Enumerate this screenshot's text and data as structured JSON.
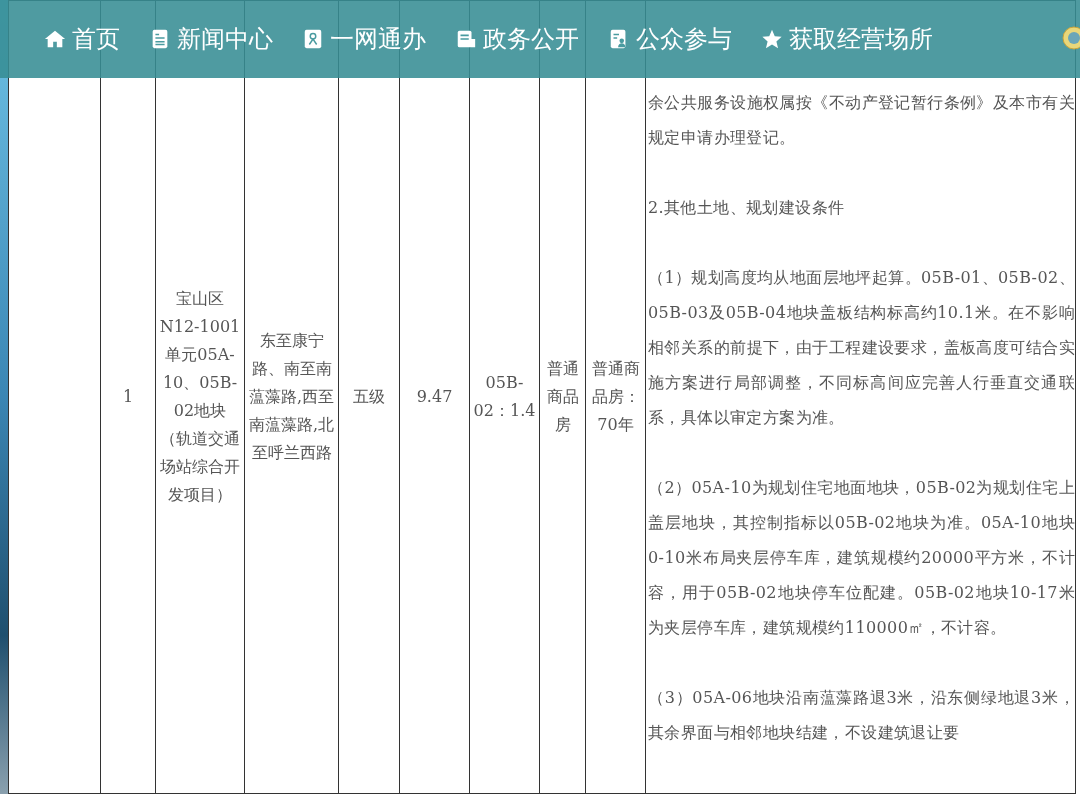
{
  "nav": {
    "items": [
      {
        "label": "首页"
      },
      {
        "label": "新闻中心"
      },
      {
        "label": "一网通办"
      },
      {
        "label": "政务公开"
      },
      {
        "label": "公众参与"
      },
      {
        "label": "获取经营场所"
      }
    ]
  },
  "table": {
    "row": {
      "cells": [
        "1",
        "宝山区N12-1001单元05A-10、05B-02地块（轨道交通场站综合开发项目）",
        "东至康宁路、南至南蕰藻路,西至南蕰藻路,北至呼兰西路",
        "五级",
        "9.47",
        "05B-02：1.4",
        "普通商品房",
        "普通商品房：70年"
      ],
      "conditions": [
        "余公共服务设施权属按《不动产登记暂行条例》及本市有关规定申请办理登记。",
        "2.其他土地、规划建设条件",
        "（1）规划高度均从地面层地坪起算。05B-01、05B-02、05B-03及05B-04地块盖板结构标高约10.1米。在不影响相邻关系的前提下，由于工程建设要求，盖板高度可结合实施方案进行局部调整，不同标高间应完善人行垂直交通联系，具体以审定方案为准。",
        "（2）05A-10为规划住宅地面地块，05B-02为规划住宅上盖层地块，其控制指标以05B-02地块为准。05A-10地块0-10米布局夹层停车库，建筑规模约20000平方米，不计容，用于05B-02地块停车位配建。05B-02地块10-17米为夹层停车库，建筑规模约110000㎡，不计容。",
        "（3）05A-06地块沿南蕰藻路退3米，沿东侧绿地退3米，其余界面与相邻地块结建，不设建筑退让要"
      ]
    }
  }
}
